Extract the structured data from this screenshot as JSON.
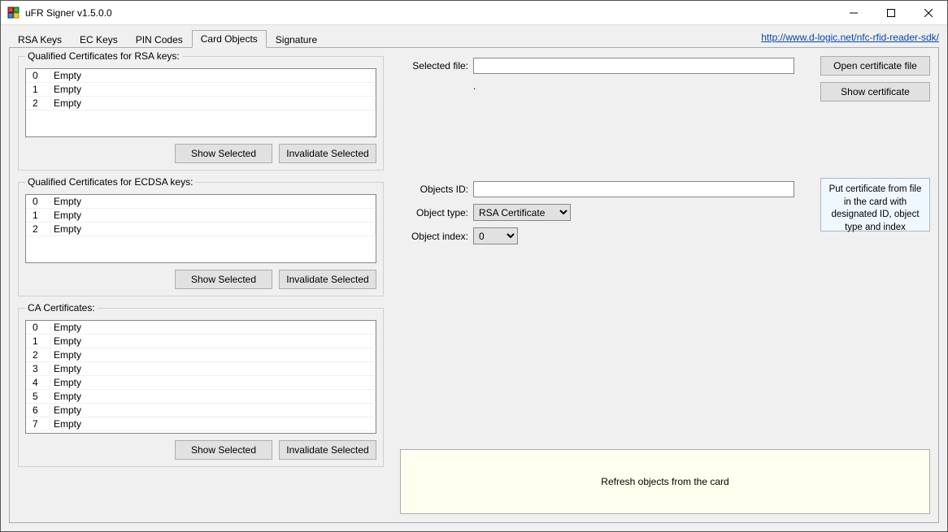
{
  "window": {
    "title": "uFR Signer v1.5.0.0"
  },
  "link": {
    "url_text": "http://www.d-logic.net/nfc-rfid-reader-sdk/"
  },
  "tabs": [
    "RSA Keys",
    "EC Keys",
    "PIN Codes",
    "Card Objects",
    "Signature"
  ],
  "active_tab": "Card Objects",
  "groups": {
    "rsa_certs": {
      "title": "Qualified Certificates for RSA keys:",
      "items": [
        {
          "idx": "0",
          "val": "Empty"
        },
        {
          "idx": "1",
          "val": "Empty"
        },
        {
          "idx": "2",
          "val": "Empty"
        }
      ],
      "show_btn": "Show Selected",
      "inv_btn": "Invalidate Selected"
    },
    "ecdsa_certs": {
      "title": "Qualified Certificates for ECDSA keys:",
      "items": [
        {
          "idx": "0",
          "val": "Empty"
        },
        {
          "idx": "1",
          "val": "Empty"
        },
        {
          "idx": "2",
          "val": "Empty"
        }
      ],
      "show_btn": "Show Selected",
      "inv_btn": "Invalidate Selected"
    },
    "ca_certs": {
      "title": "CA Certificates:",
      "items": [
        {
          "idx": "0",
          "val": "Empty"
        },
        {
          "idx": "1",
          "val": "Empty"
        },
        {
          "idx": "2",
          "val": "Empty"
        },
        {
          "idx": "3",
          "val": "Empty"
        },
        {
          "idx": "4",
          "val": "Empty"
        },
        {
          "idx": "5",
          "val": "Empty"
        },
        {
          "idx": "6",
          "val": "Empty"
        },
        {
          "idx": "7",
          "val": "Empty"
        }
      ],
      "show_btn": "Show Selected",
      "inv_btn": "Invalidate Selected"
    }
  },
  "right": {
    "selected_file_label": "Selected file:",
    "selected_file_value": "",
    "open_cert_btn": "Open certificate file",
    "show_cert_btn": "Show certificate",
    "objects_id_label": "Objects ID:",
    "objects_id_value": "",
    "object_type_label": "Object type:",
    "object_type_value": "RSA Certificate",
    "object_index_label": "Object index:",
    "object_index_value": "0",
    "info_text": "Put certificate from file in the card with designated ID, object type and index",
    "refresh_btn": "Refresh objects from the card"
  }
}
